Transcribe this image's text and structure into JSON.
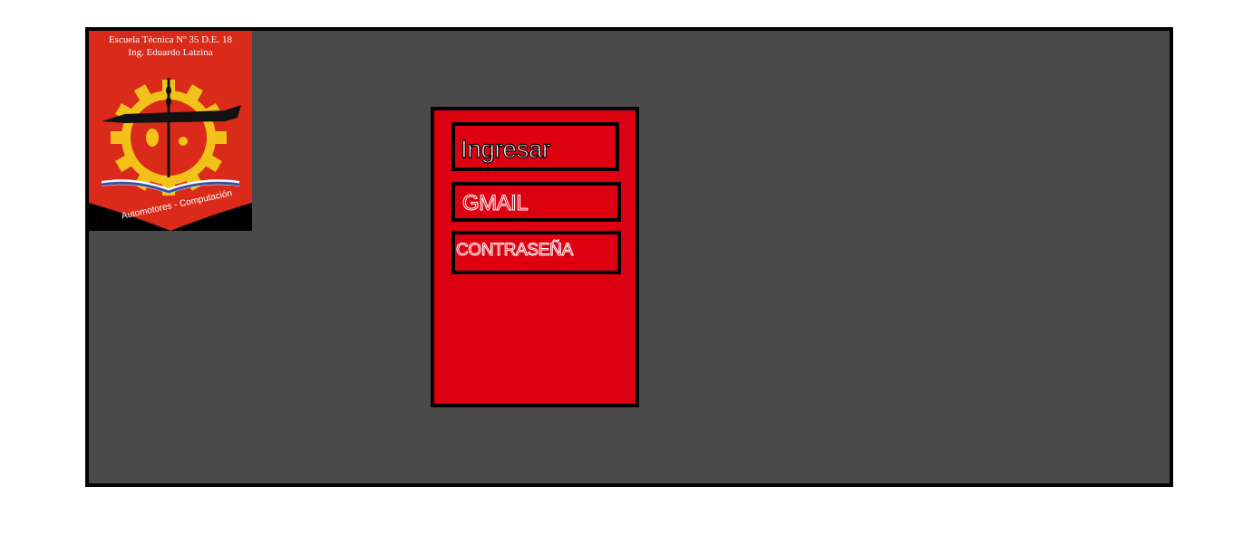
{
  "logo": {
    "line1": "Escuela Técnica Nº 35 D.E. 18",
    "line2": "Ing. Eduardo Latzina",
    "motto": "Automotores - Computación",
    "icon": "school-crest-icon"
  },
  "login": {
    "title": "Ingresar",
    "email_label": "GMAIL",
    "password_label": "CONTRASEÑA"
  },
  "colors": {
    "background": "#4a4a4a",
    "panel": "#dd0011",
    "crest_red": "#d92a1a",
    "crest_gear": "#f2c21a",
    "border": "#000000"
  }
}
